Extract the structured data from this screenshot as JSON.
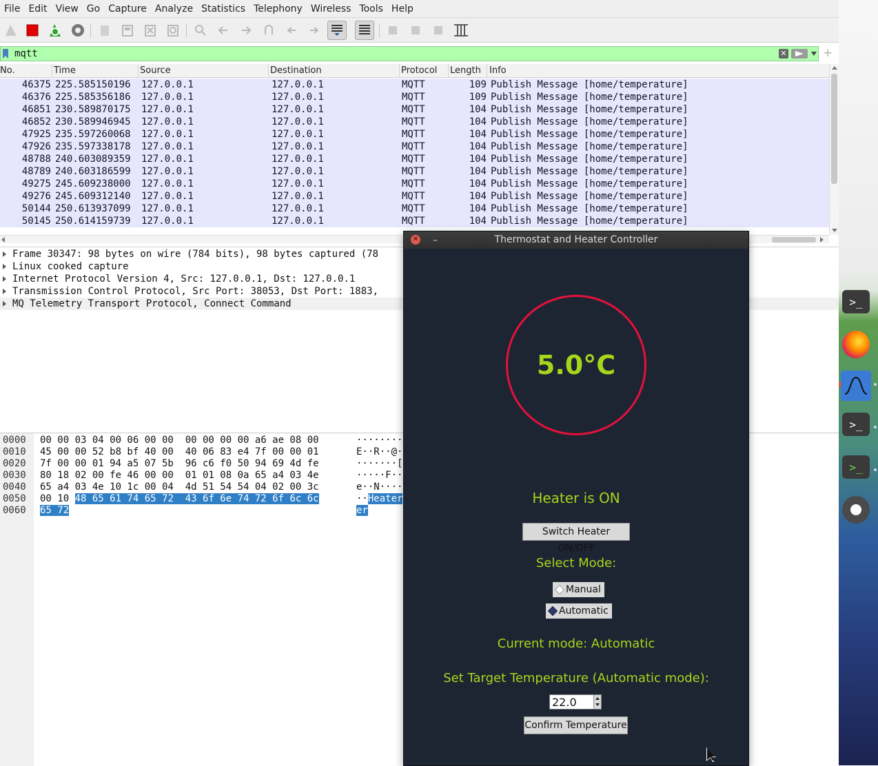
{
  "menu": [
    "File",
    "Edit",
    "View",
    "Go",
    "Capture",
    "Analyze",
    "Statistics",
    "Telephony",
    "Wireless",
    "Tools",
    "Help"
  ],
  "filter": {
    "value": "mqtt",
    "clear_label": "✕"
  },
  "columns": {
    "no": "No.",
    "time": "Time",
    "source": "Source",
    "destination": "Destination",
    "protocol": "Protocol",
    "length": "Length",
    "info": "Info"
  },
  "packets": [
    {
      "no": "46375",
      "time": "225.585150196",
      "src": "127.0.0.1",
      "dst": "127.0.0.1",
      "proto": "MQTT",
      "len": "109",
      "info": "Publish Message [home/temperature]"
    },
    {
      "no": "46376",
      "time": "225.585356186",
      "src": "127.0.0.1",
      "dst": "127.0.0.1",
      "proto": "MQTT",
      "len": "109",
      "info": "Publish Message [home/temperature]"
    },
    {
      "no": "46851",
      "time": "230.589870175",
      "src": "127.0.0.1",
      "dst": "127.0.0.1",
      "proto": "MQTT",
      "len": "104",
      "info": "Publish Message [home/temperature]"
    },
    {
      "no": "46852",
      "time": "230.589946945",
      "src": "127.0.0.1",
      "dst": "127.0.0.1",
      "proto": "MQTT",
      "len": "104",
      "info": "Publish Message [home/temperature]"
    },
    {
      "no": "47925",
      "time": "235.597260068",
      "src": "127.0.0.1",
      "dst": "127.0.0.1",
      "proto": "MQTT",
      "len": "104",
      "info": "Publish Message [home/temperature]"
    },
    {
      "no": "47926",
      "time": "235.597338178",
      "src": "127.0.0.1",
      "dst": "127.0.0.1",
      "proto": "MQTT",
      "len": "104",
      "info": "Publish Message [home/temperature]"
    },
    {
      "no": "48788",
      "time": "240.603089359",
      "src": "127.0.0.1",
      "dst": "127.0.0.1",
      "proto": "MQTT",
      "len": "104",
      "info": "Publish Message [home/temperature]"
    },
    {
      "no": "48789",
      "time": "240.603186599",
      "src": "127.0.0.1",
      "dst": "127.0.0.1",
      "proto": "MQTT",
      "len": "104",
      "info": "Publish Message [home/temperature]"
    },
    {
      "no": "49275",
      "time": "245.609238000",
      "src": "127.0.0.1",
      "dst": "127.0.0.1",
      "proto": "MQTT",
      "len": "104",
      "info": "Publish Message [home/temperature]"
    },
    {
      "no": "49276",
      "time": "245.609312140",
      "src": "127.0.0.1",
      "dst": "127.0.0.1",
      "proto": "MQTT",
      "len": "104",
      "info": "Publish Message [home/temperature]"
    },
    {
      "no": "50144",
      "time": "250.613937099",
      "src": "127.0.0.1",
      "dst": "127.0.0.1",
      "proto": "MQTT",
      "len": "104",
      "info": "Publish Message [home/temperature]"
    },
    {
      "no": "50145",
      "time": "250.614159739",
      "src": "127.0.0.1",
      "dst": "127.0.0.1",
      "proto": "MQTT",
      "len": "104",
      "info": "Publish Message [home/temperature]"
    }
  ],
  "details": [
    "Frame 30347: 98 bytes on wire (784 bits), 98 bytes captured (78",
    "Linux cooked capture",
    "Internet Protocol Version 4, Src: 127.0.0.1, Dst: 127.0.0.1",
    "Transmission Control Protocol, Src Port: 38053, Dst Port: 1883,",
    "MQ Telemetry Transport Protocol, Connect Command"
  ],
  "hex": [
    {
      "offset": "0000",
      "bytes": "00 00 03 04 00 06 00 00  00 00 00 00 a6 ae 08 00",
      "hl": "",
      "ascii": "········",
      "ascii_hl": ""
    },
    {
      "offset": "0010",
      "bytes": "45 00 00 52 b8 bf 40 00  40 06 83 e4 7f 00 00 01",
      "hl": "",
      "ascii": "E··R··@·",
      "ascii_hl": ""
    },
    {
      "offset": "0020",
      "bytes": "7f 00 00 01 94 a5 07 5b  96 c6 f0 50 94 69 4d fe",
      "hl": "",
      "ascii": "·······[",
      "ascii_hl": ""
    },
    {
      "offset": "0030",
      "bytes": "80 18 02 00 fe 46 00 00  01 01 08 0a 65 a4 03 4e",
      "hl": "",
      "ascii": "·····F··",
      "ascii_hl": ""
    },
    {
      "offset": "0040",
      "bytes": "65 a4 03 4e 10 1c 00 04  4d 51 54 54 04 02 00 3c",
      "hl": "",
      "ascii": "e··N····",
      "ascii_hl": ""
    },
    {
      "offset": "0050",
      "bytes": "00 10 ",
      "hl": "48 65 61 74 65 72  43 6f 6e 74 72 6f 6c 6c",
      "ascii": "··",
      "ascii_hl": "Heater"
    },
    {
      "offset": "0060",
      "bytes": "",
      "hl": "65 72",
      "ascii": "",
      "ascii_hl": "er"
    }
  ],
  "thermostat": {
    "title": "Thermostat and Heater Controller",
    "close_label": "✕",
    "minimize_label": "–",
    "temperature": "5.0°C",
    "heater_status": "Heater is ON",
    "switch_label": "Switch Heater ON/OFF",
    "select_mode_label": "Select Mode:",
    "mode_manual": "Manual",
    "mode_automatic": "Automatic",
    "current_mode": "Current mode: Automatic",
    "target_label": "Set Target Temperature (Automatic mode):",
    "target_value": "22.0",
    "confirm_label": "Confirm Temperature",
    "selected_mode": "Automatic"
  },
  "colors": {
    "filter_valid": "#afffaf",
    "row_mqtt": "#e7e6ff",
    "thermo_bg": "#1d2533",
    "accent_green": "#a6d61c",
    "gauge_red": "#e5113b",
    "hex_highlight": "#2f7fc6"
  },
  "icons": {
    "toolbar": [
      "shark-fin-icon",
      "stop-capture-icon",
      "restart-capture-icon",
      "capture-options-icon",
      "open-file-icon",
      "save-file-icon",
      "close-file-icon",
      "reload-file-icon",
      "find-icon",
      "back-icon",
      "forward-icon",
      "go-to-packet-icon",
      "first-packet-icon",
      "last-packet-icon",
      "auto-scroll-icon",
      "colorize-icon",
      "zoom-in-icon",
      "zoom-out-icon",
      "normal-size-icon",
      "resize-columns-icon"
    ],
    "dock": [
      "terminal-icon",
      "firefox-icon",
      "wireshark-icon",
      "terminal-icon",
      "terminal-icon",
      "settings-icon"
    ]
  }
}
